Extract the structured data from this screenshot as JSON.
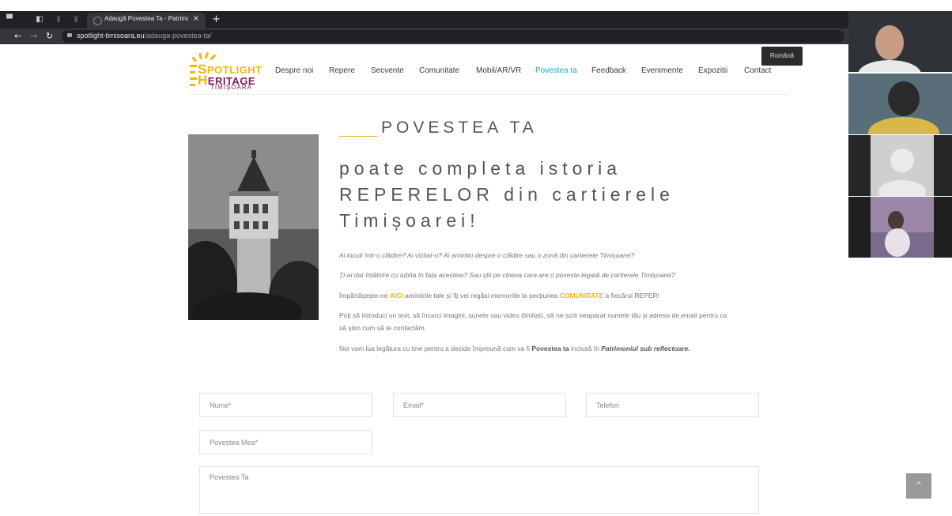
{
  "browser": {
    "tab_title": "Adaugă Povestea Ta - Patrimoniu...",
    "tab_close": "×",
    "new_tab": "+",
    "url_host": "spotlight-timisoara.eu",
    "url_path": "/adauga-povestea-ta/"
  },
  "logo": {
    "line1": "POTLIGHT",
    "line1_initial": "S",
    "line2": "ERITAGE",
    "line2_initial": "H",
    "line3": "TIMIȘOARA"
  },
  "nav": {
    "items": [
      "Despre noi",
      "Repere",
      "Secvente",
      "Comunitate",
      "Mobil/AR/VR",
      "Povestea ta",
      "Feedback",
      "Evenimente",
      "Expozitii",
      "Contact"
    ],
    "active": "Povestea ta",
    "language_tip": "Română"
  },
  "hero": {
    "section_title": "POVESTEA TA",
    "heading_line1": "poate completa istoria",
    "heading_line2": "REPERELOR din cartierele",
    "heading_line3": "Timișoarei!",
    "p1": "Ai locuit într-o clădire? Ai vizitat-o? Ai amintiri despre o clădire sau o zonă din cartierele Timișoarei?",
    "p2": "Ți-ai dat întâlnire cu iubita în fața acesteia? Sau știi pe cineva care are o poveste legată de cartierele Timișoarei?",
    "p3_a": "Împărtășește-ne ",
    "p3_link": "AICI",
    "p3_b": " amintirile tale și îți vei regăsi memoriile la secțiunea ",
    "p3_section": "COMUNITATE",
    "p3_c": " a fiecărui REPER!",
    "p4_line1": "Poți să introduci un text, să încarci imagini, sunete sau video (limitat), să ne scrii neaparat numele tău și adresa de email pentru ca",
    "p4_line2": "să știm cum să te contactăm.",
    "p5_a": "Noi vom lua legătura cu tine pentru a decide împreună cum va fi ",
    "p5_bold": "Povestea ta",
    "p5_b": " inclusă în ",
    "p5_boldit": "Patrimoniul sub reflectoare."
  },
  "form": {
    "name_placeholder": "Nume*",
    "email_placeholder": "Email*",
    "phone_placeholder": "Telefon",
    "story_title_placeholder": "Povestea Mea*",
    "story_placeholder": "Povestea Ta"
  },
  "scroll_top": "^",
  "colors": {
    "accent": "#22a7c0",
    "highlight": "#f2b705",
    "browser_dark": "#202124"
  }
}
